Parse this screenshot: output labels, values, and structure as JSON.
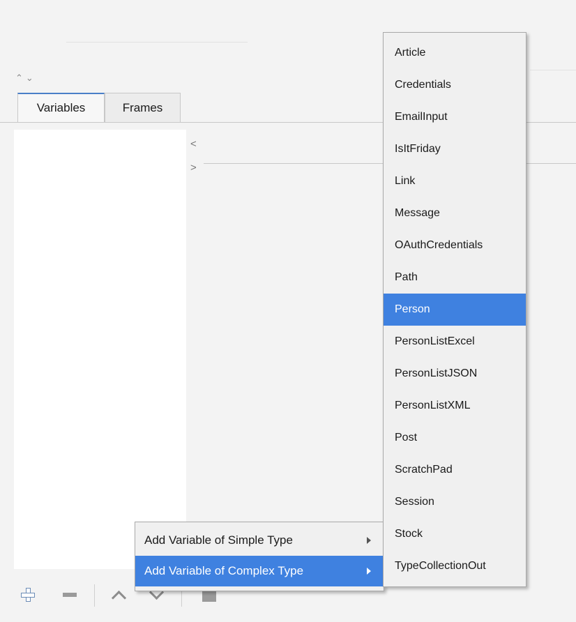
{
  "tabs": [
    {
      "label": "Variables",
      "active": true
    },
    {
      "label": "Frames",
      "active": false
    }
  ],
  "panel_toggle": {
    "collapse_up": "^",
    "collapse_down": "v"
  },
  "sash": {
    "left": "<",
    "right": ">"
  },
  "toolbar": {
    "buttons": [
      {
        "icon": "plus-icon",
        "tooltip": "add"
      },
      {
        "icon": "minus-icon",
        "tooltip": "remove"
      },
      {
        "icon": "chevron-up-icon",
        "tooltip": "move up"
      },
      {
        "icon": "chevron-down-icon",
        "tooltip": "move down"
      },
      {
        "icon": "square-icon",
        "tooltip": "clear"
      }
    ]
  },
  "context_menu": {
    "items": [
      {
        "label": "Add Variable of Simple Type",
        "selected": false
      },
      {
        "label": "Add Variable of Complex Type",
        "selected": true
      }
    ]
  },
  "type_submenu": {
    "items": [
      "Article",
      "Credentials",
      "EmailInput",
      "IsItFriday",
      "Link",
      "Message",
      "OAuthCredentials",
      "Path",
      "Person",
      "PersonListExcel",
      "PersonListJSON",
      "PersonListXML",
      "Post",
      "ScratchPad",
      "Session",
      "Stock",
      "TypeCollectionOut"
    ],
    "selected": "Person"
  },
  "colors": {
    "selection": "#3f81e0",
    "tab_accent": "#4a7fc8",
    "background": "#f3f3f3"
  }
}
